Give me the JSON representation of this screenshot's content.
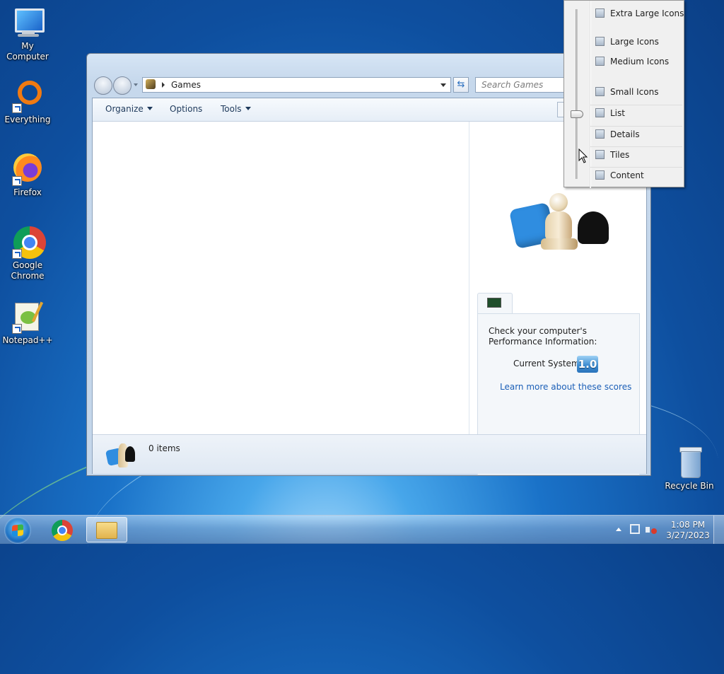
{
  "desktop": {
    "icons": [
      {
        "label": "My Computer"
      },
      {
        "label": "Everything"
      },
      {
        "label": "Firefox"
      },
      {
        "label": "Google Chrome"
      },
      {
        "label": "Notepad++"
      },
      {
        "label": "Recycle Bin"
      }
    ]
  },
  "window": {
    "address": "Games",
    "search_placeholder": "Search Games",
    "toolbar": {
      "organize": "Organize",
      "options": "Options",
      "tools": "Tools"
    },
    "status": {
      "items": "0 items"
    },
    "perf_card": {
      "text": "Check your computer's Performance Information:",
      "current_system_label": "Current System",
      "score": "1.0",
      "link": "Learn more about these scores"
    }
  },
  "view_menu": {
    "items": [
      {
        "label": "Extra Large Icons",
        "icon": "extra-large-icons-icon"
      },
      {
        "label": "Large Icons",
        "icon": "large-icons-icon"
      },
      {
        "label": "Medium Icons",
        "icon": "medium-icons-icon"
      },
      {
        "label": "Small Icons",
        "icon": "small-icons-icon"
      },
      {
        "label": "List",
        "icon": "list-view-icon"
      },
      {
        "label": "Details",
        "icon": "details-view-icon"
      },
      {
        "label": "Tiles",
        "icon": "tiles-view-icon"
      },
      {
        "label": "Content",
        "icon": "content-view-icon"
      }
    ]
  },
  "taskbar": {
    "time": "1:08 PM",
    "date": "3/27/2023"
  },
  "colors": {
    "accent": "#1b5fb7",
    "desktop": "#1a72c8"
  }
}
